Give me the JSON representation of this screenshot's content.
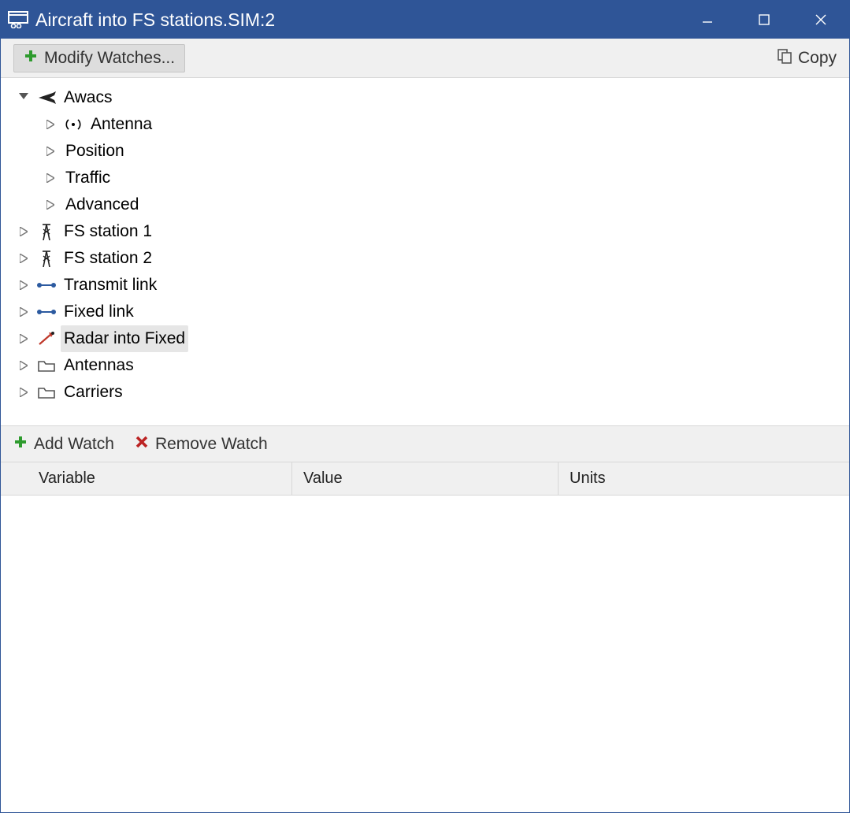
{
  "window": {
    "title": "Aircraft into FS stations.SIM:2"
  },
  "toolbar": {
    "modify_watches": "Modify Watches...",
    "copy": "Copy"
  },
  "tree": {
    "awacs": {
      "label": "Awacs",
      "children": {
        "antenna": "Antenna",
        "position": "Position",
        "traffic": "Traffic",
        "advanced": "Advanced"
      }
    },
    "fs_station_1": "FS station 1",
    "fs_station_2": "FS station 2",
    "transmit_link": "Transmit link",
    "fixed_link": "Fixed link",
    "radar_into_fixed": "Radar into Fixed",
    "antennas": "Antennas",
    "carriers": "Carriers"
  },
  "watch_toolbar": {
    "add_watch": "Add Watch",
    "remove_watch": "Remove Watch"
  },
  "watch_columns": {
    "variable": "Variable",
    "value": "Value",
    "units": "Units"
  }
}
